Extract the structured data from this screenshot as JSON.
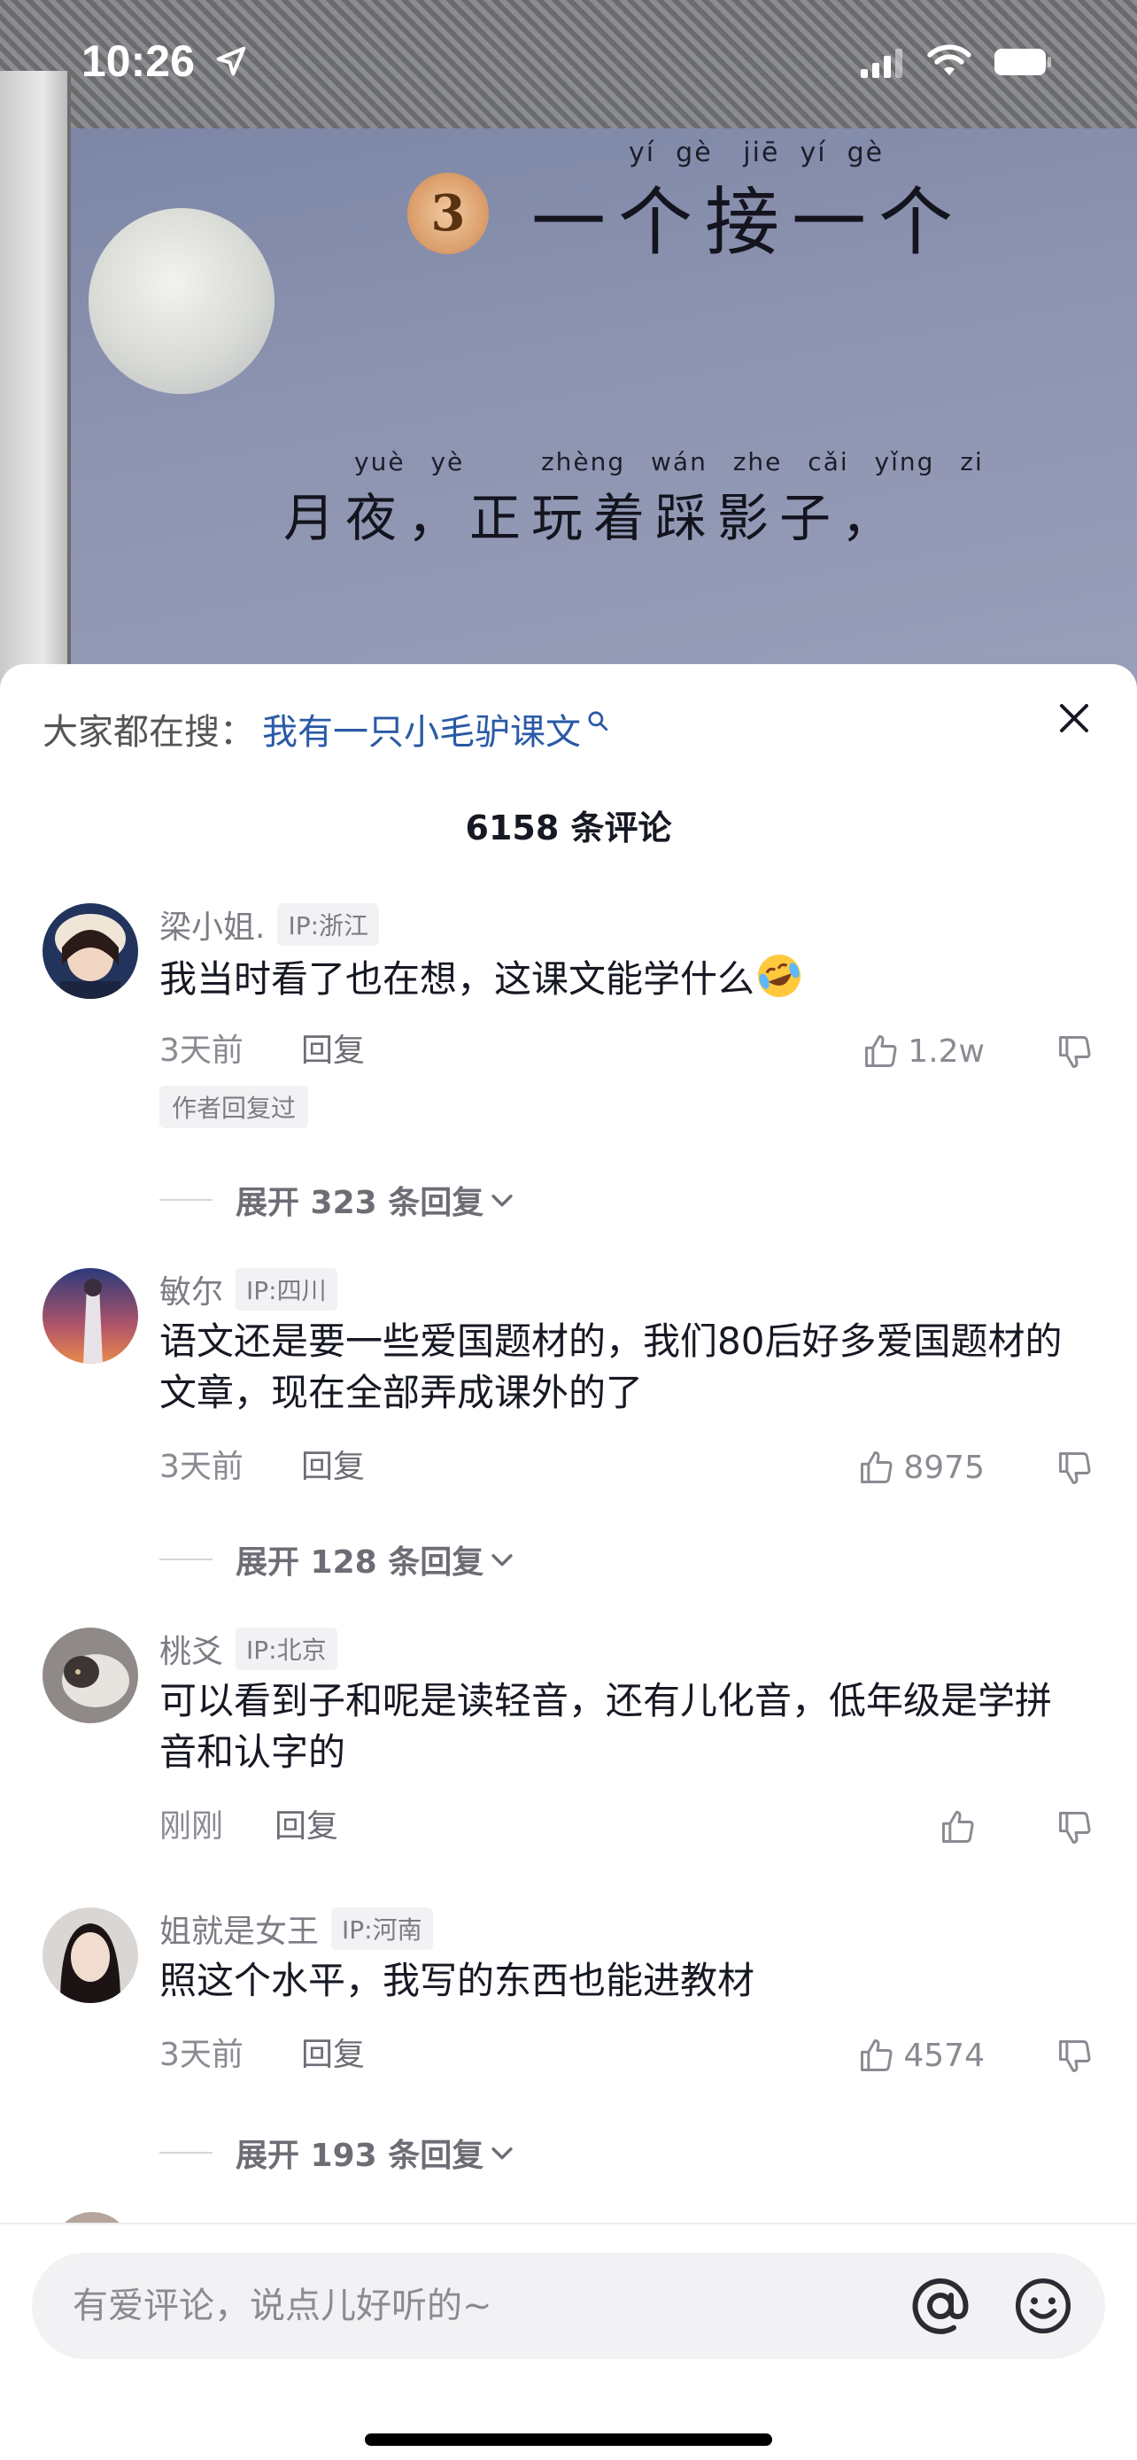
{
  "status_bar": {
    "time": "10:26"
  },
  "video": {
    "lesson_number": "3",
    "title_pinyin": "yí  gè   jiē  yí  gè",
    "title_hanzi": "一个接一个",
    "verse_pinyin": "yuè yè   zhèng wán zhe cǎi yǐng zi",
    "verse_hanzi": "月夜，正玩着踩影子，"
  },
  "sheet": {
    "trending_label": "大家都在搜：",
    "trending_term": "我有一只小毛驴课文",
    "comment_count": "6158 条评论"
  },
  "comments": [
    {
      "username": "梁小姐.",
      "ip": "IP:浙江",
      "text": "我当时看了也在想，这课文能学什么",
      "time": "3天前",
      "reply_label": "回复",
      "likes": "1.2w",
      "author_tag": "作者回复过",
      "expand_label": "展开 323 条回复"
    },
    {
      "username": "敏尔",
      "ip": "IP:四川",
      "text": "语文还是要一些爱国题材的，我们80后好多爱国题材的文章，现在全部弄成课外的了",
      "time": "3天前",
      "reply_label": "回复",
      "likes": "8975",
      "expand_label": "展开 128 条回复"
    },
    {
      "username": "桃爻",
      "ip": "IP:北京",
      "text": "可以看到子和呢是读轻音，还有儿化音，低年级是学拼音和认字的",
      "time": "刚刚",
      "reply_label": "回复",
      "likes": ""
    },
    {
      "username": "姐就是女王",
      "ip": "IP:河南",
      "text": "照这个水平，我写的东西也能进教材",
      "time": "3天前",
      "reply_label": "回复",
      "likes": "4574",
      "expand_label": "展开 193 条回复"
    }
  ],
  "input": {
    "placeholder": "有爱评论，说点儿好听的~"
  },
  "colors": {
    "link": "#2a5aa6",
    "text": "#161823",
    "muted": "#8a8a92"
  }
}
